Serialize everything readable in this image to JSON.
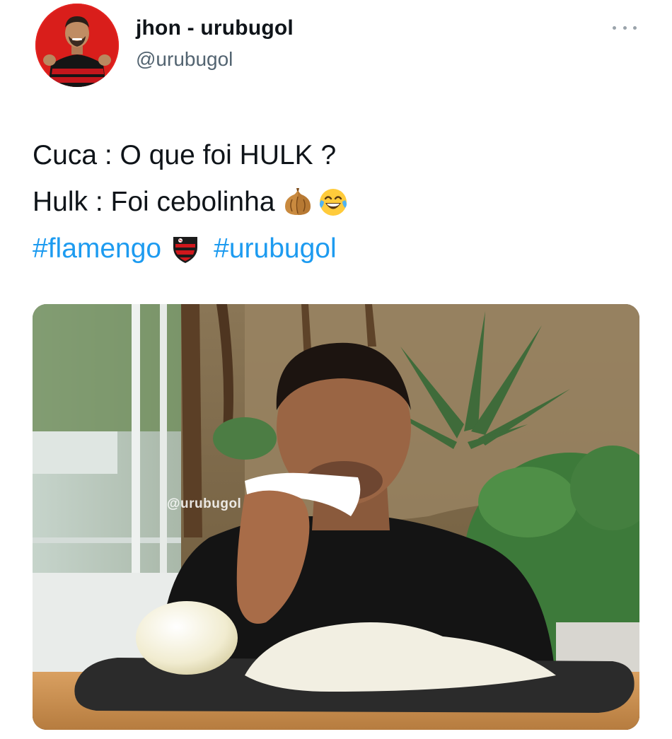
{
  "author": {
    "display_name": "jhon - urubugol",
    "handle": "@urubugol"
  },
  "tweet": {
    "line1": "Cuca : O que foi HULK ?",
    "line2": "Hulk : Foi cebolinha",
    "line2_emojis": [
      "onion-emoji",
      "tears-of-joy-emoji"
    ],
    "hashtag1": "#flamengo",
    "hashtag1_emoji": "flamengo-crest-emoji",
    "hashtag2": "#urubugol"
  },
  "media": {
    "watermark": "@urubugol"
  },
  "colors": {
    "link": "#1d9bf0",
    "text": "#0f1419",
    "secondary": "#536471"
  }
}
